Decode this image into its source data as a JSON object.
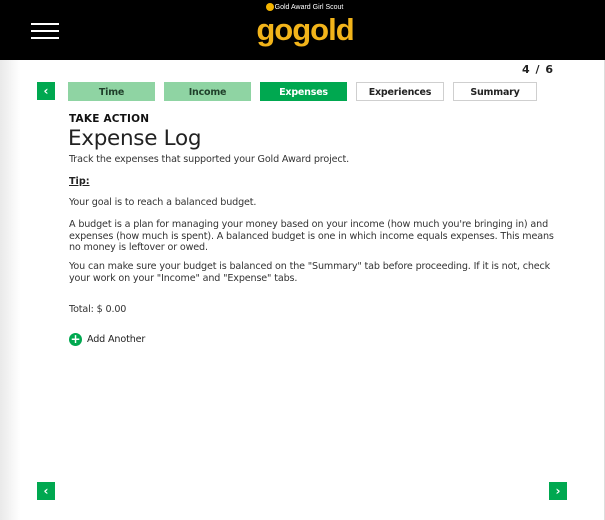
{
  "header": {
    "logo_tagline": "Gold Award Girl Scout",
    "logo_word": "gogold"
  },
  "progress": {
    "page_counter": "4 / 6",
    "prev_glyph": "‹",
    "next_glyph": "›"
  },
  "tabs": [
    {
      "label": "Time",
      "state": "done"
    },
    {
      "label": "Income",
      "state": "done"
    },
    {
      "label": "Expenses",
      "state": "active"
    },
    {
      "label": "Experiences",
      "state": "todo"
    },
    {
      "label": "Summary",
      "state": "todo"
    }
  ],
  "main": {
    "kicker": "TAKE ACTION",
    "title": "Expense Log",
    "subtitle": "Track the expenses that supported your Gold Award project.",
    "tip_label": "Tip:",
    "paragraphs": [
      "Your goal is to reach a balanced budget.",
      "A budget is a plan for managing your money based on your income (how much you're bringing in) and expenses (how much is spent). A balanced budget is one in which income equals expenses. This means no money is leftover or owed.",
      "You can make sure your budget is balanced on the \"Summary\" tab before proceeding. If it is not, check your work on your \"Income\" and \"Expense\" tabs."
    ],
    "total": "Total: $ 0.00",
    "add_another": "Add Another",
    "add_icon_glyph": "+"
  },
  "footer": {
    "prev_glyph": "‹",
    "next_glyph": "›"
  },
  "colors": {
    "header_bg": "#000000",
    "brand_gold": "#f2b41a",
    "accent_green": "#00a850",
    "completed_tab_green": "#8fd4a3"
  },
  "icons": {
    "menu": "hamburger-menu-icon",
    "prev": "chevron-left-icon",
    "next": "chevron-right-icon",
    "add": "plus-circle-icon"
  }
}
